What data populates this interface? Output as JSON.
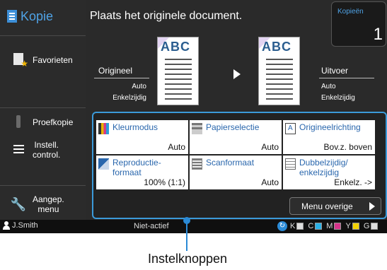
{
  "app_title": "Kopie",
  "sidebar": {
    "favorites": "Favorieten",
    "proof": "Proefkopie",
    "settings_line1": "Instell.",
    "settings_line2": "control.",
    "custom_line1": "Aangep.",
    "custom_line2": "menu"
  },
  "status_message": "Plaats het originele document.",
  "copies": {
    "label": "Kopieën",
    "value": "1"
  },
  "original": {
    "label": "Origineel",
    "line1": "Auto",
    "line2": "Enkelzijdig"
  },
  "output": {
    "label": "Uitvoer",
    "line1": "Auto",
    "line2": "Enkelzijdig"
  },
  "preview_text": "ABC",
  "tiles": [
    {
      "label": "Kleurmodus",
      "value": "Auto",
      "icon": "color-mode-icon"
    },
    {
      "label": "Papierselectie",
      "value": "Auto",
      "icon": "paper-tray-icon"
    },
    {
      "label": "Origineelrichting",
      "value": "Bov.z. boven",
      "icon": "orientation-icon"
    },
    {
      "label": "Reproductie-\nformaat",
      "value": "100% (1:1)",
      "icon": "reproduction-size-icon"
    },
    {
      "label": "Scanformaat",
      "value": "Auto",
      "icon": "scan-size-icon"
    },
    {
      "label": "Dubbelzijdig/\nenkelzijdig",
      "value": "Enkelz. ->",
      "icon": "duplex-icon"
    }
  ],
  "more_menu": "Menu overige",
  "statusbar": {
    "user": "J.Smith",
    "state": "Niet-actief",
    "inks": [
      "K",
      "C",
      "M",
      "Y",
      "G"
    ]
  },
  "colors": {
    "accent": "#3b9ad9",
    "tile_label": "#2a67ad"
  },
  "callout_label": "Instelknoppen"
}
